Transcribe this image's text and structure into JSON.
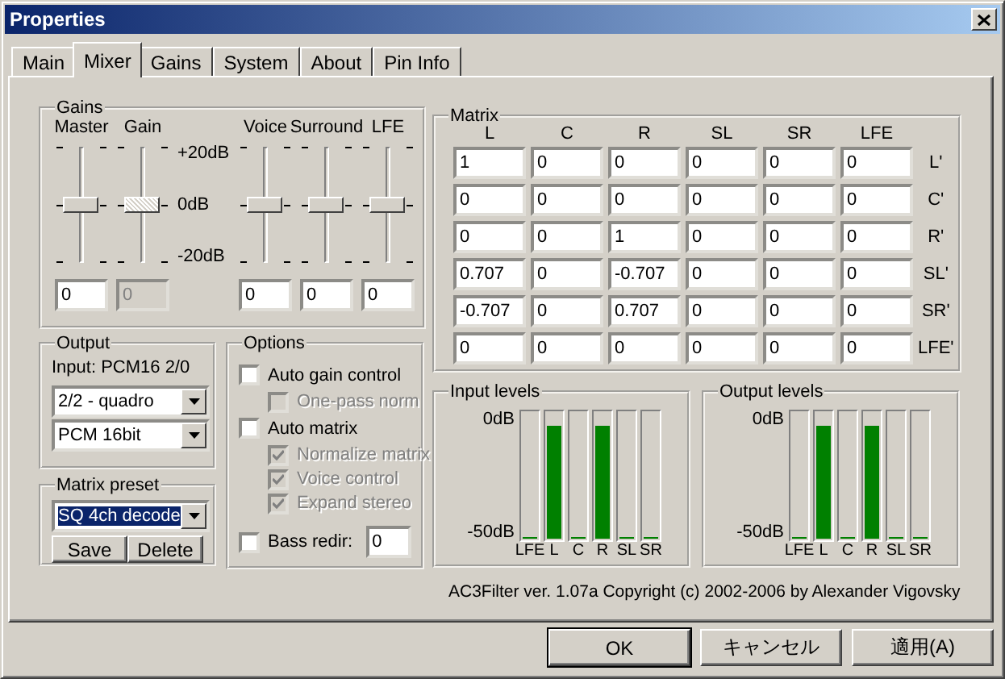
{
  "window": {
    "title": "Properties"
  },
  "tabs": [
    {
      "label": "Main",
      "selected": false
    },
    {
      "label": "Mixer",
      "selected": true
    },
    {
      "label": "Gains",
      "selected": false
    },
    {
      "label": "System",
      "selected": false
    },
    {
      "label": "About",
      "selected": false
    },
    {
      "label": "Pin Info",
      "selected": false
    }
  ],
  "gains": {
    "title": "Gains",
    "scale": [
      "+20dB",
      "0dB",
      "-20dB"
    ],
    "sliders": [
      {
        "label": "Master",
        "level": 0.5,
        "value": "0",
        "disabled": false
      },
      {
        "label": "Gain",
        "level": 0.5,
        "value": "0",
        "disabled": true
      },
      {
        "label": "Voice",
        "level": 0.5,
        "value": "0",
        "disabled": false
      },
      {
        "label": "Surround",
        "level": 0.5,
        "value": "0",
        "disabled": false
      },
      {
        "label": "LFE",
        "level": 0.5,
        "value": "0",
        "disabled": false
      }
    ]
  },
  "output": {
    "title": "Output",
    "input_info": "Input: PCM16 2/0",
    "selects": [
      "2/2 - quadro",
      "PCM 16bit"
    ]
  },
  "matrix_preset": {
    "title": "Matrix preset",
    "value": "SQ 4ch decode",
    "highlighted": true,
    "buttons": [
      "Save",
      "Delete"
    ]
  },
  "options": {
    "title": "Options",
    "items": [
      {
        "kind": "checkbox",
        "label": "Auto gain control",
        "checked": false,
        "disabled": false,
        "children": [
          {
            "kind": "checkbox",
            "label": "One-pass norm",
            "checked": false,
            "disabled": true
          }
        ]
      },
      {
        "kind": "checkbox",
        "label": "Auto matrix",
        "checked": false,
        "disabled": false,
        "children": [
          {
            "kind": "checkbox",
            "label": "Normalize matrix",
            "checked": true,
            "disabled": true
          },
          {
            "kind": "checkbox",
            "label": "Voice control",
            "checked": true,
            "disabled": true
          },
          {
            "kind": "checkbox",
            "label": "Expand stereo",
            "checked": true,
            "disabled": true
          }
        ]
      },
      {
        "kind": "checkbox-field",
        "label": "Bass redir:",
        "checked": false,
        "disabled": false,
        "value": "0"
      }
    ]
  },
  "matrix": {
    "title": "Matrix",
    "columns": [
      "L",
      "C",
      "R",
      "SL",
      "SR",
      "LFE"
    ],
    "rows": [
      {
        "label": "L'",
        "cells": [
          "1",
          "0",
          "0",
          "0",
          "0",
          "0"
        ]
      },
      {
        "label": "C'",
        "cells": [
          "0",
          "0",
          "0",
          "0",
          "0",
          "0"
        ]
      },
      {
        "label": "R'",
        "cells": [
          "0",
          "0",
          "1",
          "0",
          "0",
          "0"
        ]
      },
      {
        "label": "SL'",
        "cells": [
          "0.707",
          "0",
          "-0.707",
          "0",
          "0",
          "0"
        ]
      },
      {
        "label": "SR'",
        "cells": [
          "-0.707",
          "0",
          "0.707",
          "0",
          "0",
          "0"
        ]
      },
      {
        "label": "LFE'",
        "cells": [
          "0",
          "0",
          "0",
          "0",
          "0",
          "0"
        ]
      }
    ]
  },
  "input_levels": {
    "title": "Input levels",
    "top": "0dB",
    "bottom": "-50dB",
    "channels": [
      {
        "name": "LFE",
        "level": 0
      },
      {
        "name": "L",
        "level": 0.9
      },
      {
        "name": "C",
        "level": 0
      },
      {
        "name": "R",
        "level": 0.9
      },
      {
        "name": "SL",
        "level": 0
      },
      {
        "name": "SR",
        "level": 0
      }
    ]
  },
  "output_levels": {
    "title": "Output levels",
    "top": "0dB",
    "bottom": "-50dB",
    "channels": [
      {
        "name": "LFE",
        "level": 0
      },
      {
        "name": "L",
        "level": 0.9
      },
      {
        "name": "C",
        "level": 0
      },
      {
        "name": "R",
        "level": 0.9
      },
      {
        "name": "SL",
        "level": 0
      },
      {
        "name": "SR",
        "level": 0
      }
    ]
  },
  "copyright": "AC3Filter ver. 1.07a Copyright (c) 2002-2006 by Alexander Vigovsky",
  "buttons": [
    "OK",
    "キャンセル",
    "適用(A)"
  ]
}
